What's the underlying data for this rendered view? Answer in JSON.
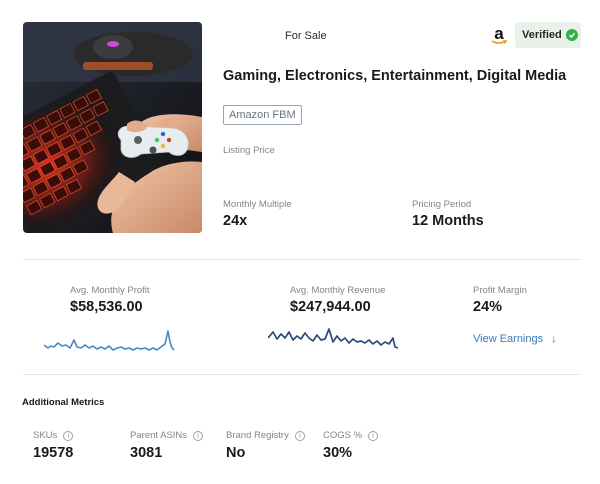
{
  "listing": {
    "status": "For Sale",
    "verified_label": "Verified",
    "title": "Gaming, Electronics, Entertainment, Digital Media",
    "channel": "Amazon FBM",
    "listing_price_label": "Listing Price",
    "monthly_multiple_label": "Monthly Multiple",
    "monthly_multiple_value": "24x",
    "pricing_period_label": "Pricing Period",
    "pricing_period_value": "12 Months"
  },
  "financials": {
    "avg_profit_label": "Avg. Monthly Profit",
    "avg_profit_value": "$58,536.00",
    "avg_revenue_label": "Avg. Monthly Revenue",
    "avg_revenue_value": "$247,944.00",
    "profit_margin_label": "Profit Margin",
    "profit_margin_value": "24%",
    "view_earnings_label": "View Earnings",
    "view_earnings_arrow": "↓"
  },
  "additional_metrics": {
    "title": "Additional Metrics",
    "items": [
      {
        "label": "SKUs",
        "value": "19578"
      },
      {
        "label": "Parent ASINs",
        "value": "3081"
      },
      {
        "label": "Brand Registry",
        "value": "No"
      },
      {
        "label": "COGS %",
        "value": "30%"
      }
    ]
  },
  "colors": {
    "profit_line": "#4a88c8",
    "revenue_line": "#2b4a78",
    "verified_bg": "#eaf1ea",
    "verified_check": "#2fb24c",
    "link": "#3d7ab8"
  },
  "icons": [
    "amazon-logo-icon",
    "check-circle-icon",
    "info-icon",
    "arrow-down-icon"
  ]
}
